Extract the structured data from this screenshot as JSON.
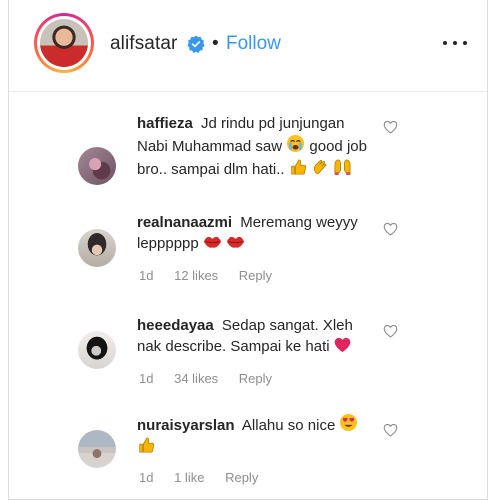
{
  "header": {
    "username": "alifsatar",
    "separator": "•",
    "follow_label": "Follow",
    "verified_color": "#3897f0"
  },
  "comments": [
    {
      "user": "haffieza",
      "text_1": "Jd rindu pd junjungan Nabi Muhammad saw",
      "text_2": "good job bro.. sampai dlm hati..",
      "emojis": [
        "crying-face",
        "thumbs-up",
        "clapping-hands",
        "raising-hands"
      ]
    },
    {
      "user": "realnanaazmi",
      "text": "Meremang weyyy lepppppp",
      "emojis": [
        "kiss-lips",
        "kiss-lips"
      ],
      "time": "1d",
      "likes": "12 likes",
      "reply": "Reply"
    },
    {
      "user": "heeedayaa",
      "text": "Sedap sangat. Xleh nak describe. Sampai ke hati",
      "emojis": [
        "red-heart"
      ],
      "time": "1d",
      "likes": "34 likes",
      "reply": "Reply"
    },
    {
      "user": "nuraisyarslan",
      "text": "Allahu so nice",
      "emojis": [
        "heart-eyes-face",
        "thumbs-up"
      ],
      "time": "1d",
      "likes": "1 like",
      "reply": "Reply"
    }
  ]
}
